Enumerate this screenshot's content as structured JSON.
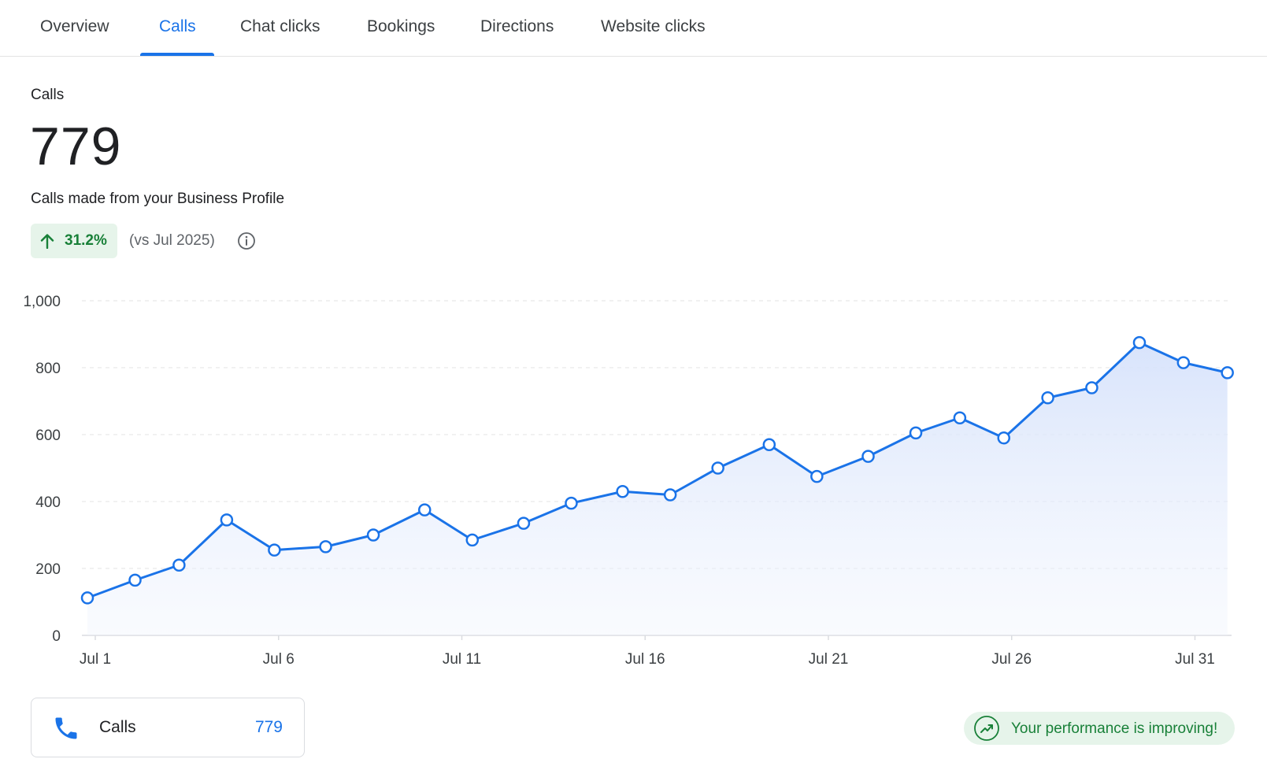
{
  "tabs": [
    {
      "label": "Overview",
      "active": false
    },
    {
      "label": "Calls",
      "active": true
    },
    {
      "label": "Chat clicks",
      "active": false
    },
    {
      "label": "Bookings",
      "active": false
    },
    {
      "label": "Directions",
      "active": false
    },
    {
      "label": "Website clicks",
      "active": false
    }
  ],
  "metric": {
    "label": "Calls",
    "value": "779",
    "description": "Calls made from your Business Profile",
    "change": "31.2%",
    "change_direction": "up",
    "comparison": "(vs Jul 2025)",
    "info_icon": "info-icon"
  },
  "chart_data": {
    "type": "area",
    "x": [
      "Jul 1",
      "Jul 2",
      "Jul 3",
      "Jul 4",
      "Jul 5",
      "Jul 6",
      "Jul 7",
      "Jul 8",
      "Jul 9",
      "Jul 10",
      "Jul 11",
      "Jul 12",
      "Jul 13",
      "Jul 14",
      "Jul 15",
      "Jul 16",
      "Jul 17",
      "Jul 18",
      "Jul 19",
      "Jul 20",
      "Jul 21",
      "Jul 22",
      "Jul 23",
      "Jul 24",
      "Jul 25",
      "Jul 26",
      "Jul 27",
      "Jul 28",
      "Jul 29",
      "Jul 30",
      "Jul 31"
    ],
    "series": [
      {
        "values": [
          112,
          165,
          210,
          345,
          255,
          265,
          300,
          375,
          285,
          335,
          395,
          430,
          420,
          500,
          570,
          475,
          535,
          605,
          650,
          590,
          710,
          740,
          875,
          815,
          785
        ]
      }
    ],
    "x_positions_days": [
      1,
      2.3,
      3.5,
      4.8,
      6.1,
      7.5,
      8.8,
      10.2,
      11.5,
      12.9,
      14.2,
      15.6,
      16.9,
      18.2,
      19.6,
      20.9,
      22.3,
      23.6,
      24.8,
      26.0,
      27.2,
      28.4,
      29.7,
      30.9,
      32.1
    ],
    "x_ticks": [
      "Jul 1",
      "Jul 6",
      "Jul 11",
      "Jul 16",
      "Jul 21",
      "Jul 26",
      "Jul 31"
    ],
    "y_ticks": [
      "0",
      "200",
      "400",
      "600",
      "800",
      "1,000"
    ],
    "ylim": [
      0,
      1000
    ],
    "grid": true,
    "line_color": "#1a73e8",
    "fill_color": "#d6e2fb"
  },
  "legend": {
    "icon": "phone-icon",
    "label": "Calls",
    "value": "779",
    "color": "#1a73e8"
  },
  "performance": {
    "icon": "trending-up-icon",
    "text": "Your performance is improving!",
    "color": "#188038"
  }
}
